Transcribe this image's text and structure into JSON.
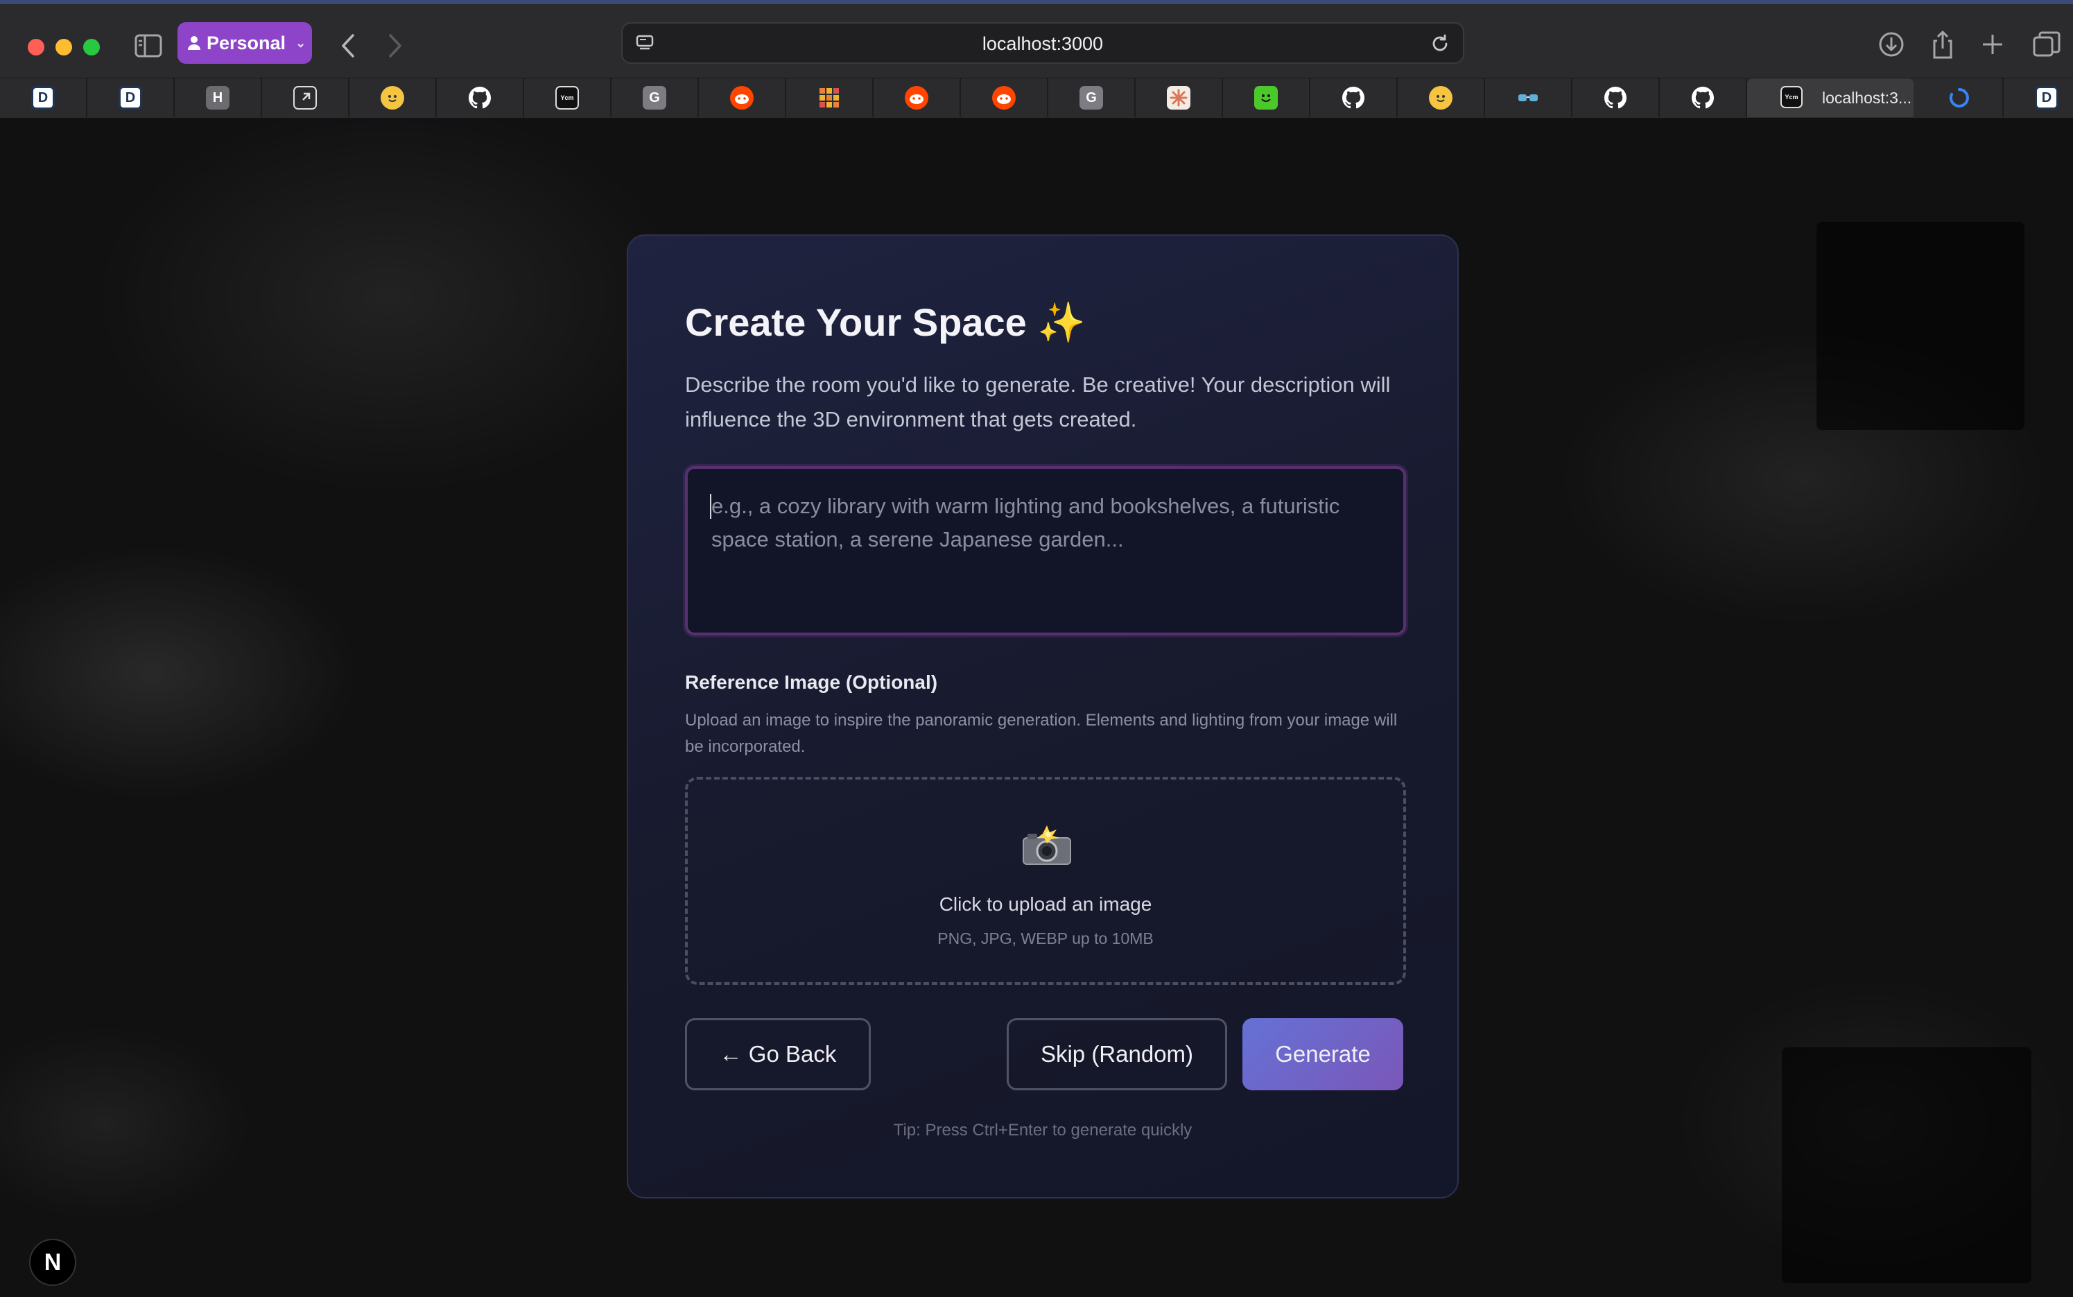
{
  "browser": {
    "profile_label": "Personal",
    "url": "localhost:3000",
    "active_tab_title": "localhost:3...",
    "pinned_tabs": [
      {
        "icon": "d-app-icon",
        "letter": "D",
        "color": "#1d3557"
      },
      {
        "icon": "d-app-icon",
        "letter": "D",
        "color": "#1d3557"
      },
      {
        "icon": "h-letter-icon",
        "letter": "H",
        "color": "#6b6b70"
      },
      {
        "icon": "square-arrow-icon",
        "letter": "",
        "color": "#444448"
      },
      {
        "icon": "huggingface-icon",
        "letter": "",
        "color": "#f5c542"
      },
      {
        "icon": "github-icon",
        "letter": "",
        "color": "#2b2b2d"
      },
      {
        "icon": "ycombinator-icon",
        "letter": "",
        "color": "#111111"
      },
      {
        "icon": "g-letter-icon",
        "letter": "G",
        "color": "#7c7c82"
      },
      {
        "icon": "reddit-icon",
        "letter": "",
        "color": "#ff4500"
      },
      {
        "icon": "grid-icon",
        "letter": "",
        "color": "#e8833a"
      },
      {
        "icon": "reddit-icon",
        "letter": "",
        "color": "#ff4500"
      },
      {
        "icon": "reddit-icon",
        "letter": "",
        "color": "#ff4500"
      },
      {
        "icon": "g-letter-icon",
        "letter": "G",
        "color": "#7c7c82"
      },
      {
        "icon": "claude-icon",
        "letter": "",
        "color": "#d9775a"
      },
      {
        "icon": "smiley-icon",
        "letter": "",
        "color": "#4cc92a"
      },
      {
        "icon": "github-icon",
        "letter": "",
        "color": "#2b2b2d"
      },
      {
        "icon": "huggingface-icon",
        "letter": "",
        "color": "#f5c542"
      },
      {
        "icon": "glasses-icon",
        "letter": "",
        "color": "#2b2b2d"
      },
      {
        "icon": "github-icon",
        "letter": "",
        "color": "#2b2b2d"
      },
      {
        "icon": "github-icon",
        "letter": "",
        "color": "#2b2b2d"
      },
      {
        "icon": "loading-spinner-icon",
        "letter": "",
        "color": "#2b2b2d"
      },
      {
        "icon": "d-app-icon",
        "letter": "D",
        "color": "#1d3557"
      }
    ]
  },
  "modal": {
    "title": "Create Your Space ✨",
    "description": "Describe the room you'd like to generate. Be creative! Your description will influence the 3D environment that gets created.",
    "prompt_placeholder": "e.g., a cozy library with warm lighting and bookshelves, a futuristic space station, a serene Japanese garden...",
    "prompt_value": "",
    "reference": {
      "title": "Reference Image (Optional)",
      "description": "Upload an image to inspire the panoramic generation. Elements and lighting from your image will be incorporated.",
      "upload_label": "Click to upload an image",
      "upload_hint": "PNG, JPG, WEBP up to 10MB"
    },
    "buttons": {
      "back": "← Go Back",
      "skip": "Skip (Random)",
      "generate": "Generate"
    },
    "tip": "Tip: Press Ctrl+Enter to generate quickly"
  },
  "nextjs_badge": "N",
  "colors": {
    "accent_gradient_start": "#6571d6",
    "accent_gradient_end": "#7a57b8",
    "focus_border": "#57306e",
    "profile_color": "#8e44c8"
  }
}
